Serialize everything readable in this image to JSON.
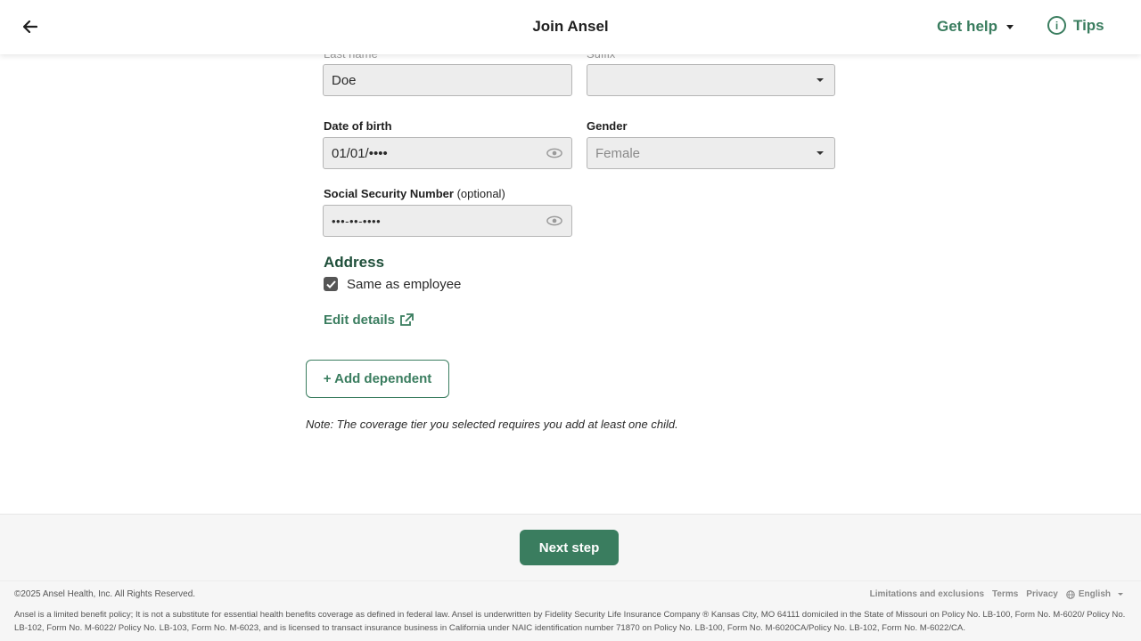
{
  "header": {
    "title": "Join Ansel",
    "get_help": "Get help",
    "tips": "Tips"
  },
  "form": {
    "last_name": {
      "label": "Last name",
      "value": "Doe"
    },
    "suffix": {
      "label": "Suffix",
      "value": ""
    },
    "date_of_birth": {
      "label": "Date of birth",
      "value": "01/01/••••"
    },
    "gender": {
      "label": "Gender",
      "value": "Female"
    },
    "ssn": {
      "label": "Social Security Number",
      "optional": "(optional)",
      "value": "•••-••-••••"
    }
  },
  "address": {
    "heading": "Address",
    "same_as_employee": "Same as employee",
    "checked": true,
    "edit_details": "Edit details"
  },
  "add_dependent": "+ Add dependent",
  "note": "Note: The coverage tier you selected requires you add at least one child.",
  "next_step": "Next step",
  "footer": {
    "copyright": "©2025 Ansel Health, Inc. All Rights Reserved.",
    "links": [
      "Limitations and exclusions",
      "Terms",
      "Privacy"
    ],
    "language": "English",
    "disclaimer": "Ansel is a limited benefit policy; It is not a substitute for essential health benefits coverage as defined in federal law. Ansel is underwritten by Fidelity Security Life Insurance Company ® Kansas City, MO 64111 domiciled in the State of Missouri on Policy No. LB-100, Form No. M-6020/ Policy No. LB-102, Form No. M-6022/ Policy No. LB-103, Form No. M-6023, and is licensed to transact insurance business in California under NAIC identification number 71870 on Policy No. LB-100, Form No. M-6020CA/Policy No. LB-102, Form No. M-6022/CA."
  },
  "colors": {
    "brand_green": "#3a7d5f",
    "heading_green": "#1f4f3a",
    "input_bg": "#ededed"
  }
}
